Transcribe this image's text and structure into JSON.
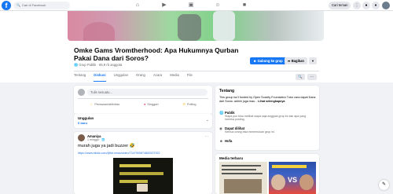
{
  "topbar": {
    "logo": "f",
    "search_placeholder": "Cari di Facebook",
    "nav_icons": [
      "home-icon",
      "video-icon",
      "marketplace-icon",
      "groups-icon",
      "gaming-icon"
    ],
    "find_friends": "Cari teman",
    "right_icons": [
      "menu-icon",
      "messenger-icon",
      "notifications-icon"
    ]
  },
  "group": {
    "title": "Omke Gams Vromtherhood: Apa Hukumnya Qurban Pakai Dana dari Soros?",
    "meta": "Grup Publik · 65,9 rb anggota",
    "join_label": "Gabung ke grup",
    "share_label": "Bagikan",
    "more_label": "▾"
  },
  "tabs": [
    "Tentang",
    "Diskusi",
    "Unggulan",
    "Orang",
    "Acara",
    "Media",
    "File"
  ],
  "active_tab": "Diskusi",
  "composer": {
    "placeholder": "Tulis sesuatu...",
    "actions": [
      "Perasaan/aktivitas",
      "Singgah",
      "Polling"
    ]
  },
  "featured": {
    "heading": "Unggulan",
    "sub": "6 baru"
  },
  "post": {
    "author": "Amaniya",
    "time": "1 minggu · ",
    "text": "murah juga ya jadi buzzer 🤣",
    "link": "https://www.tiktok.com/@tkt.news/video/7347900874862537922"
  },
  "about": {
    "heading": "Tentang",
    "description": "This group isn't funded by Open Society Foundation Tutor cara dapat Dana dari Soros: admin juga mau... ",
    "more": "Lihat selengkapnya",
    "rows": [
      {
        "title": "Publik",
        "desc": "Siapa pun bisa melihat siapa saja anggota grup ini dan apa yang mereka posting."
      },
      {
        "title": "Dapat dilihat",
        "desc": "Semua orang bisa menemukan grup ini."
      },
      {
        "title": "Hofa",
        "desc": ""
      }
    ]
  },
  "media": {
    "heading": "Media terbaru"
  },
  "colors": {
    "accent": "#1877f2",
    "background": "#f0f2f5"
  }
}
